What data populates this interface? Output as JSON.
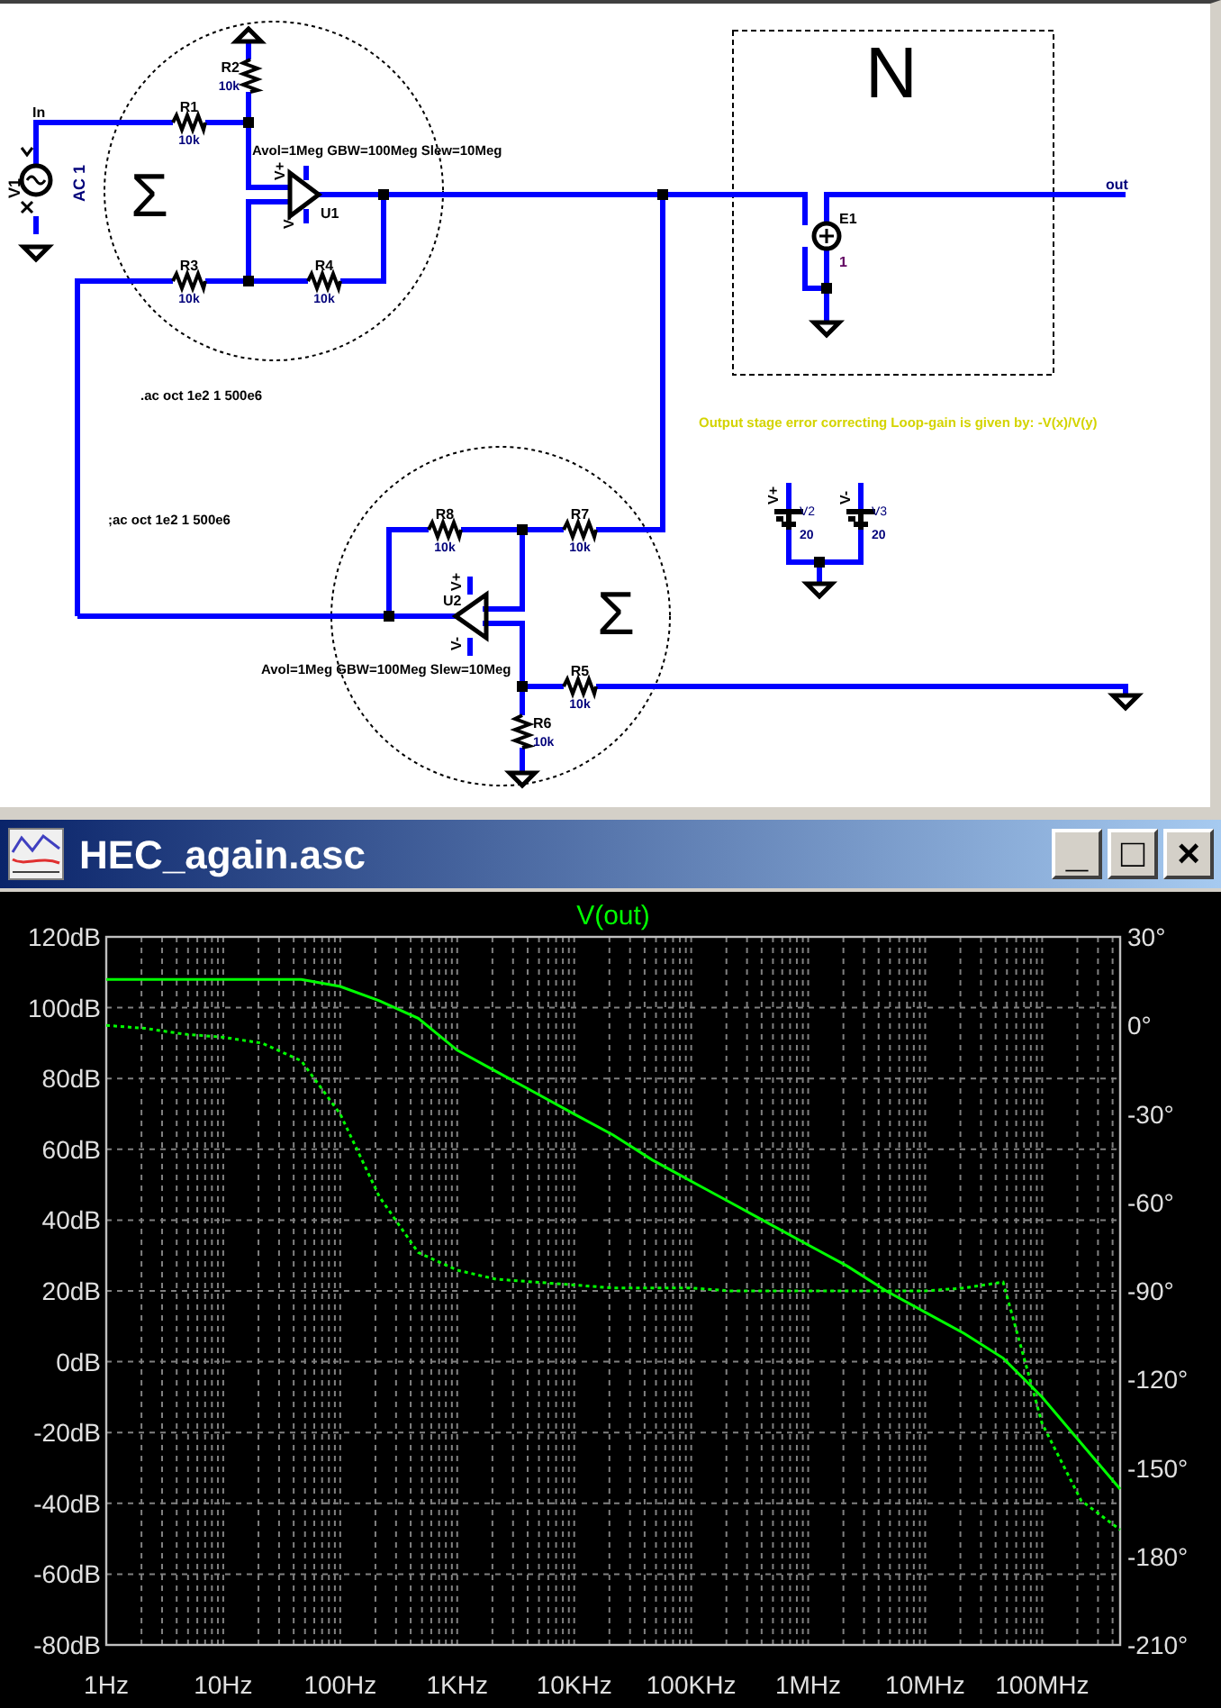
{
  "schematic": {
    "net_labels": [
      "In",
      "out"
    ],
    "sources": [
      {
        "ref": "V1",
        "value": "AC 1"
      },
      {
        "ref": "V2",
        "value": "20",
        "pin": "V+"
      },
      {
        "ref": "V3",
        "value": "20",
        "pin": "V-"
      }
    ],
    "resistors": [
      {
        "ref": "R1",
        "value": "10k"
      },
      {
        "ref": "R2",
        "value": "10k"
      },
      {
        "ref": "R3",
        "value": "10k"
      },
      {
        "ref": "R4",
        "value": "10k"
      },
      {
        "ref": "R5",
        "value": "10k"
      },
      {
        "ref": "R6",
        "value": "10k"
      },
      {
        "ref": "R7",
        "value": "10k"
      },
      {
        "ref": "R8",
        "value": "10k"
      }
    ],
    "opamps": [
      {
        "ref": "U1",
        "pins": [
          "V+",
          "V-"
        ],
        "model": "Avol=1Meg GBW=100Meg Slew=10Meg"
      },
      {
        "ref": "U2",
        "pins": [
          "V+",
          "V-"
        ],
        "model": "Avol=1Meg GBW=100Meg Slew=10Meg"
      }
    ],
    "dependent_source": {
      "ref": "E1",
      "value": "1"
    },
    "block_symbols": [
      "Σ",
      "N",
      "Σ"
    ],
    "directives": [
      ".ac oct 1e2 1 500e6",
      ";ac oct 1e2 1 500e6"
    ],
    "comment": "Output stage error correcting Loop-gain is given by: -V(x)/V(y)"
  },
  "plot_window": {
    "title": "HEC_again.asc",
    "buttons": [
      "_",
      "□",
      "×"
    ],
    "chart_data": {
      "type": "line",
      "title": "V(out)",
      "grid": true,
      "ylim": [
        -80,
        120
      ],
      "y2lim": [
        -210,
        30
      ],
      "categories": [
        "1Hz",
        null,
        null,
        "10Hz",
        null,
        null,
        "100Hz",
        null,
        null,
        "1KHz",
        null,
        null,
        "10KHz",
        null,
        null,
        "100KHz",
        null,
        null,
        "1MHz",
        null,
        null,
        "10MHz",
        null,
        null,
        "100MHz",
        null,
        null
      ],
      "yticks": [
        {
          "value": 120,
          "label": "120dB"
        },
        {
          "value": 100,
          "label": "100dB"
        },
        {
          "value": 80,
          "label": "80dB"
        },
        {
          "value": 60,
          "label": "60dB"
        },
        {
          "value": 40,
          "label": "40dB"
        },
        {
          "value": 20,
          "label": "20dB"
        },
        {
          "value": 0,
          "label": "0dB"
        },
        {
          "value": -20,
          "label": "-20dB"
        },
        {
          "value": -40,
          "label": "-40dB"
        },
        {
          "value": -60,
          "label": "-60dB"
        },
        {
          "value": -80,
          "label": "-80dB"
        }
      ],
      "y2ticks": [
        {
          "value": 30,
          "label": "30°"
        },
        {
          "value": 0,
          "label": "0°"
        },
        {
          "value": -30,
          "label": "-30°"
        },
        {
          "value": -60,
          "label": "-60°"
        },
        {
          "value": -90,
          "label": "-90°"
        },
        {
          "value": -120,
          "label": "-120°"
        },
        {
          "value": -150,
          "label": "-150°"
        },
        {
          "value": -180,
          "label": "-180°"
        },
        {
          "value": -210,
          "label": "-210°"
        }
      ],
      "series": [
        {
          "color": "#00ff00",
          "values": [
            108,
            108,
            108,
            108,
            108,
            108,
            106,
            102,
            97,
            88,
            82,
            76,
            70,
            64,
            57,
            51,
            45,
            39,
            33,
            27,
            20,
            14,
            8,
            1,
            -10,
            -23,
            -36
          ]
        },
        {
          "axis": "y2",
          "line_style": "dotted",
          "color": "#00ff00",
          "values": [
            0,
            -1,
            -3,
            -4,
            -6,
            -12,
            -30,
            -58,
            -77,
            -83,
            -86,
            -87,
            -88,
            -89,
            -89,
            -89,
            -90,
            -90,
            -90,
            -90,
            -90,
            -90,
            -89,
            -87,
            -135,
            -161,
            -171
          ]
        }
      ]
    }
  }
}
